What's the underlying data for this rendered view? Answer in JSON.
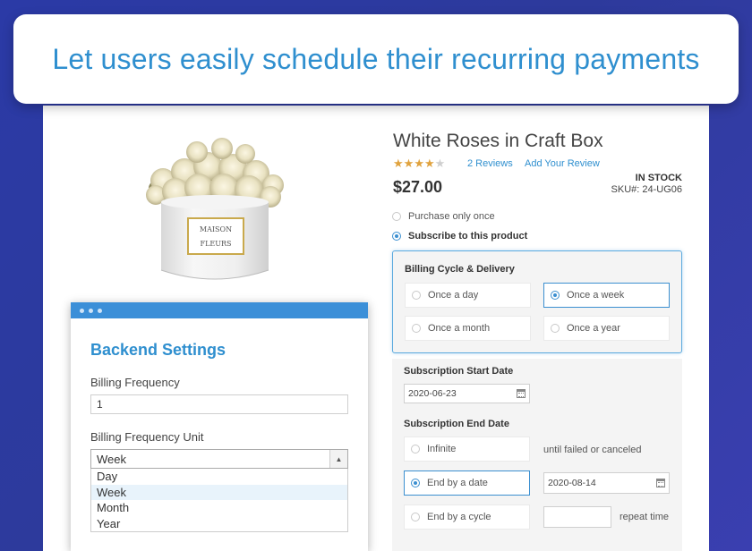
{
  "banner": {
    "headline": "Let users easily schedule their recurring payments"
  },
  "product": {
    "title": "White Roses in Craft Box",
    "rating": {
      "value": 4,
      "max": 5
    },
    "reviews_link": "2 Reviews",
    "add_review_link": "Add Your Review",
    "stock": "IN STOCK",
    "sku": "SKU#: 24-UG06",
    "price": "$27.00",
    "box_text_line1": "MAISON",
    "box_text_line2": "FLEURS"
  },
  "purchase": {
    "once_label": "Purchase only once",
    "subscribe_label": "Subscribe to this product",
    "selected": "subscribe"
  },
  "billing_cycle": {
    "title": "Billing Cycle & Delivery",
    "options": [
      "Once a day",
      "Once a week",
      "Once a month",
      "Once a year"
    ],
    "selected": "Once a week"
  },
  "subscription": {
    "start_label": "Subscription Start Date",
    "start_date": "2020-06-23",
    "end_label": "Subscription End Date",
    "infinite_label": "Infinite",
    "infinite_note": "until failed or canceled",
    "end_by_date_label": "End by a date",
    "end_date": "2020-08-14",
    "end_by_cycle_label": "End by a cycle",
    "cycle_count": "",
    "repeat_label": "repeat time",
    "selected": "End by a date"
  },
  "backend": {
    "title": "Backend Settings",
    "frequency_label": "Billing Frequency",
    "frequency_value": "1",
    "unit_label": "Billing Frequency Unit",
    "unit_selected": "Week",
    "unit_options": [
      "Day",
      "Week",
      "Month",
      "Year"
    ],
    "highlighted_option": "Week"
  },
  "colors": {
    "accent": "#2f8fcf",
    "star": "#e0a23d",
    "backend_bar": "#3b8fd8",
    "background": "#2d3a9c"
  }
}
